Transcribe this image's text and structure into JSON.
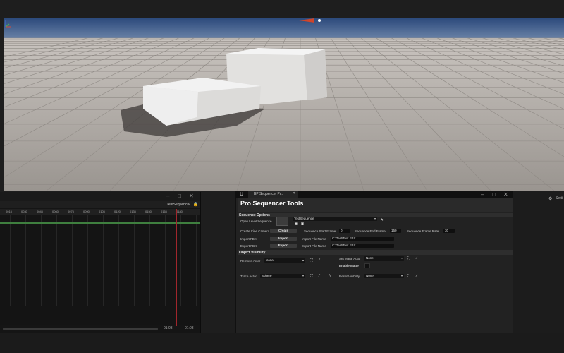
{
  "colors": {
    "sky": "#3f5e8f",
    "floor": "#b6b0ab",
    "panel_bg": "#222222",
    "playhead": "#a0262c",
    "timeline_green": "#3f7f3f"
  },
  "timeline": {
    "window_controls": [
      "–",
      "□",
      "✕"
    ],
    "sequence_name": "TestSequence•",
    "ruler_ticks": [
      "0015",
      "0030",
      "0045",
      "0060",
      "0075",
      "0090",
      "0105",
      "0120",
      "0135",
      "0150",
      "0165",
      "0180"
    ],
    "current_time": "01:03",
    "end_time": "01:03"
  },
  "tools_tab": {
    "tab_label": "BP Sequencer Pr...",
    "close": "✕",
    "window_controls": [
      "–",
      "□",
      "✕"
    ]
  },
  "panel": {
    "title": "Pro Sequencer Tools",
    "sequence_options": {
      "header": "Sequence Options",
      "open_level_sequence_label": "Open Level Sequence",
      "level_sequence_value": "TestSequence",
      "create_cine_camera_label": "Create Cine Camera",
      "create_button": "Create",
      "start_frame_label": "Sequence Start Frame",
      "start_frame_value": "0",
      "end_frame_label": "Sequence End Frame",
      "end_frame_value": "150",
      "frame_rate_label": "Sequence Frame Rate",
      "frame_rate_value": "30",
      "import_fbx_label": "Import FBX",
      "import_button": "Import",
      "import_file_label": "Import File Name",
      "import_file_value": "C:\\Test\\Test.FBX",
      "export_fbx_label": "Export FBX",
      "export_button": "Export",
      "export_file_label": "Export File Name",
      "export_file_value": "C:\\Test\\Test.FBX"
    },
    "object_visibility": {
      "header": "Object Visibility",
      "remove_actor_label": "Remove Actor",
      "remove_actor_value": "None",
      "set_matte_actor_label": "Set Matte Actor",
      "set_matte_actor_value": "None",
      "enable_matte_label": "Enable Matte",
      "trace_actor_label": "Trace Actor",
      "trace_actor_value": "Sphere",
      "reset_visibility_label": "Reset Visibility",
      "reset_visibility_value": "None"
    }
  },
  "right_panel": {
    "tab_label": "Setti"
  }
}
